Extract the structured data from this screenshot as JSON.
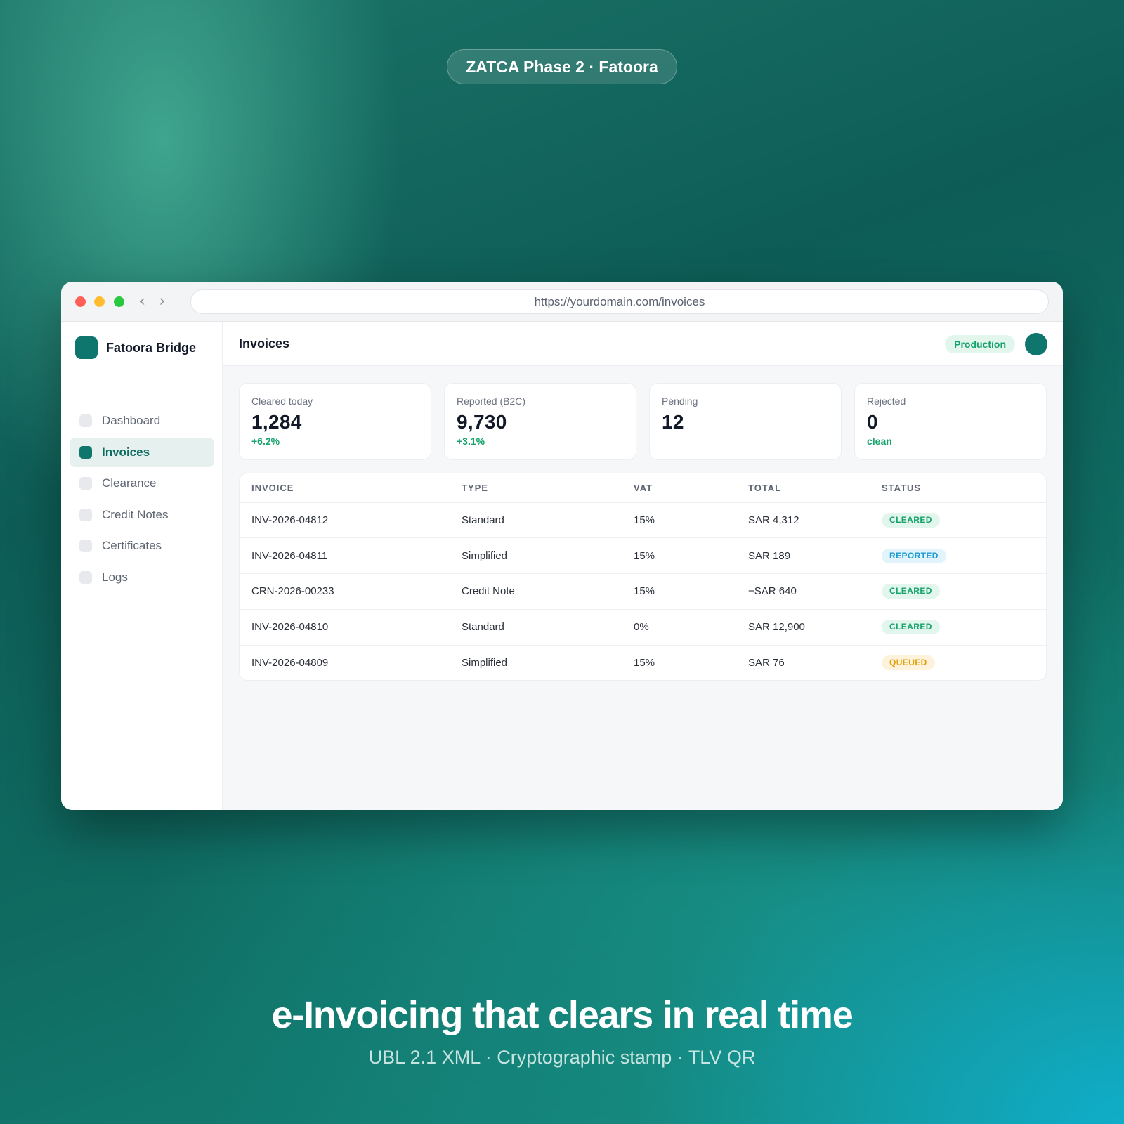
{
  "badge": "ZATCA Phase 2 · Fatoora",
  "browser": {
    "url": "https://yourdomain.com/invoices",
    "back_glyph": "‹",
    "forward_glyph": "›"
  },
  "sidebar": {
    "brand": "Fatoora Bridge",
    "items": [
      {
        "label": "Dashboard",
        "active": false
      },
      {
        "label": "Invoices",
        "active": true
      },
      {
        "label": "Clearance",
        "active": false
      },
      {
        "label": "Credit Notes",
        "active": false
      },
      {
        "label": "Certificates",
        "active": false
      },
      {
        "label": "Logs",
        "active": false
      }
    ]
  },
  "header": {
    "title": "Invoices",
    "environment": "Production"
  },
  "stats": [
    {
      "label": "Cleared today",
      "value": "1,284",
      "delta": "+6.2%"
    },
    {
      "label": "Reported (B2C)",
      "value": "9,730",
      "delta": "+3.1%"
    },
    {
      "label": "Pending",
      "value": "12",
      "delta": ""
    },
    {
      "label": "Rejected",
      "value": "0",
      "delta": "clean"
    }
  ],
  "table": {
    "columns": [
      "INVOICE",
      "TYPE",
      "VAT",
      "TOTAL",
      "STATUS"
    ],
    "rows": [
      {
        "invoice": "INV-2026-04812",
        "type": "Standard",
        "vat": "15%",
        "total": "SAR 4,312",
        "status": "CLEARED"
      },
      {
        "invoice": "INV-2026-04811",
        "type": "Simplified",
        "vat": "15%",
        "total": "SAR 189",
        "status": "REPORTED"
      },
      {
        "invoice": "CRN-2026-00233",
        "type": "Credit Note",
        "vat": "15%",
        "total": "−SAR 640",
        "status": "CLEARED"
      },
      {
        "invoice": "INV-2026-04810",
        "type": "Standard",
        "vat": "0%",
        "total": "SAR 12,900",
        "status": "CLEARED"
      },
      {
        "invoice": "INV-2026-04809",
        "type": "Simplified",
        "vat": "15%",
        "total": "SAR 76",
        "status": "QUEUED"
      }
    ]
  },
  "headline": "e-Invoicing that clears in real time",
  "subline": "UBL 2.1 XML · Cryptographic stamp · TLV QR",
  "colors": {
    "brand": "#0f766e",
    "status_cleared": "#16a36c",
    "status_reported": "#1a9bd1",
    "status_queued": "#e3a008"
  }
}
